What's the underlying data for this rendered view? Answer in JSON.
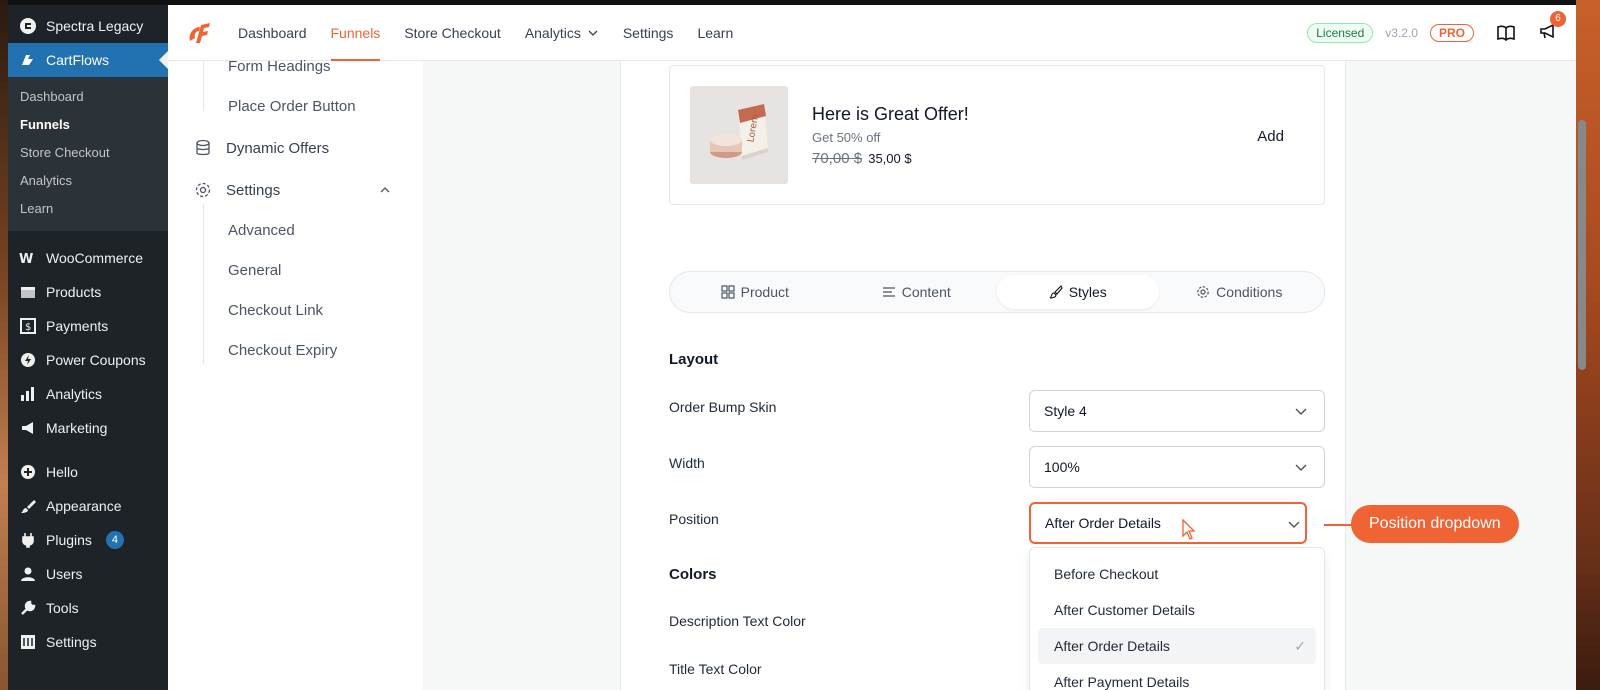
{
  "wp_menu": {
    "top": [
      {
        "label": "Spectra Legacy",
        "icon": "spectra-icon"
      },
      {
        "label": "CartFlows",
        "icon": "cartflows-icon",
        "active": true
      }
    ],
    "sub": [
      "Dashboard",
      "Funnels",
      "Store Checkout",
      "Analytics",
      "Learn"
    ],
    "current_sub": "Funnels",
    "items": [
      {
        "label": "WooCommerce",
        "icon": "woo-icon"
      },
      {
        "label": "Products",
        "icon": "box-icon"
      },
      {
        "label": "Payments",
        "icon": "payments-icon"
      },
      {
        "label": "Power Coupons",
        "icon": "coupon-icon"
      },
      {
        "label": "Analytics",
        "icon": "bar-chart-icon"
      },
      {
        "label": "Marketing",
        "icon": "megaphone-icon"
      }
    ],
    "items2": [
      {
        "label": "Hello",
        "icon": "plus-circle-icon"
      },
      {
        "label": "Appearance",
        "icon": "brush-icon"
      },
      {
        "label": "Plugins",
        "icon": "plug-icon",
        "badge": "4"
      },
      {
        "label": "Users",
        "icon": "user-icon"
      },
      {
        "label": "Tools",
        "icon": "wrench-icon"
      },
      {
        "label": "Settings",
        "icon": "sliders-icon"
      }
    ]
  },
  "topnav": {
    "links": [
      "Dashboard",
      "Funnels",
      "Store Checkout",
      "Analytics",
      "Settings",
      "Learn"
    ],
    "active": "Funnels",
    "licensed": "Licensed",
    "version": "v3.2.0",
    "pro": "PRO",
    "notifications": "6"
  },
  "settings_menu": {
    "sub_top": [
      "Form Headings",
      "Place Order Button"
    ],
    "dynamic_offers": "Dynamic Offers",
    "settings": "Settings",
    "sub_settings": [
      "Advanced",
      "General",
      "Checkout Link",
      "Checkout Expiry"
    ]
  },
  "offer": {
    "title": "Here is Great Offer!",
    "description": "Get 50% off",
    "old_price": "70,00 $",
    "new_price": "35,00 $",
    "add_label": "Add"
  },
  "tabs": [
    "Product",
    "Content",
    "Styles",
    "Conditions"
  ],
  "active_tab": "Styles",
  "layout": {
    "title": "Layout",
    "skin_label": "Order Bump Skin",
    "skin_value": "Style 4",
    "width_label": "Width",
    "width_value": "100%",
    "position_label": "Position",
    "position_value": "After Order Details"
  },
  "colors": {
    "title": "Colors",
    "desc_text_color": "Description Text Color",
    "title_text_color": "Title Text Color"
  },
  "position_options": [
    "Before Checkout",
    "After Customer Details",
    "After Order Details",
    "After Payment Details"
  ],
  "position_selected": "After Order Details",
  "callout": "Position dropdown",
  "accent": "#f06335"
}
